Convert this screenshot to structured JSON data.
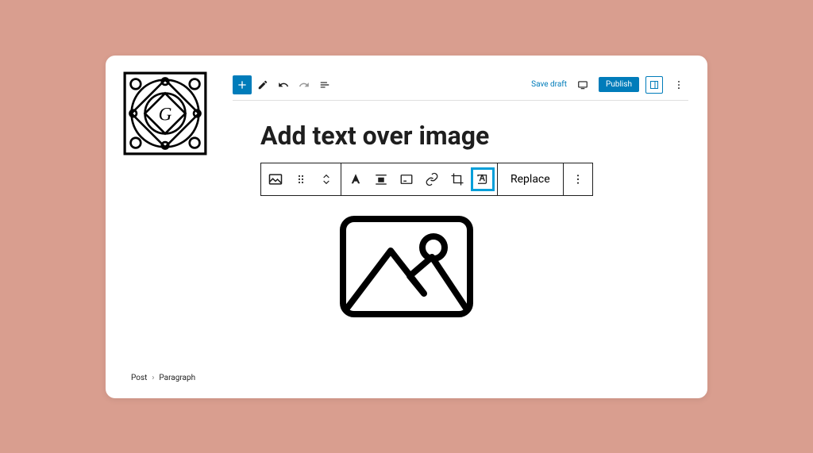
{
  "toolbar": {
    "save_draft": "Save draft",
    "publish": "Publish"
  },
  "post": {
    "title": "Add text over image"
  },
  "block_toolbar": {
    "replace": "Replace"
  },
  "breadcrumb": {
    "root": "Post",
    "current": "Paragraph"
  },
  "colors": {
    "background": "#d99e8f",
    "primary": "#007cba",
    "active_border": "#049fd9"
  }
}
